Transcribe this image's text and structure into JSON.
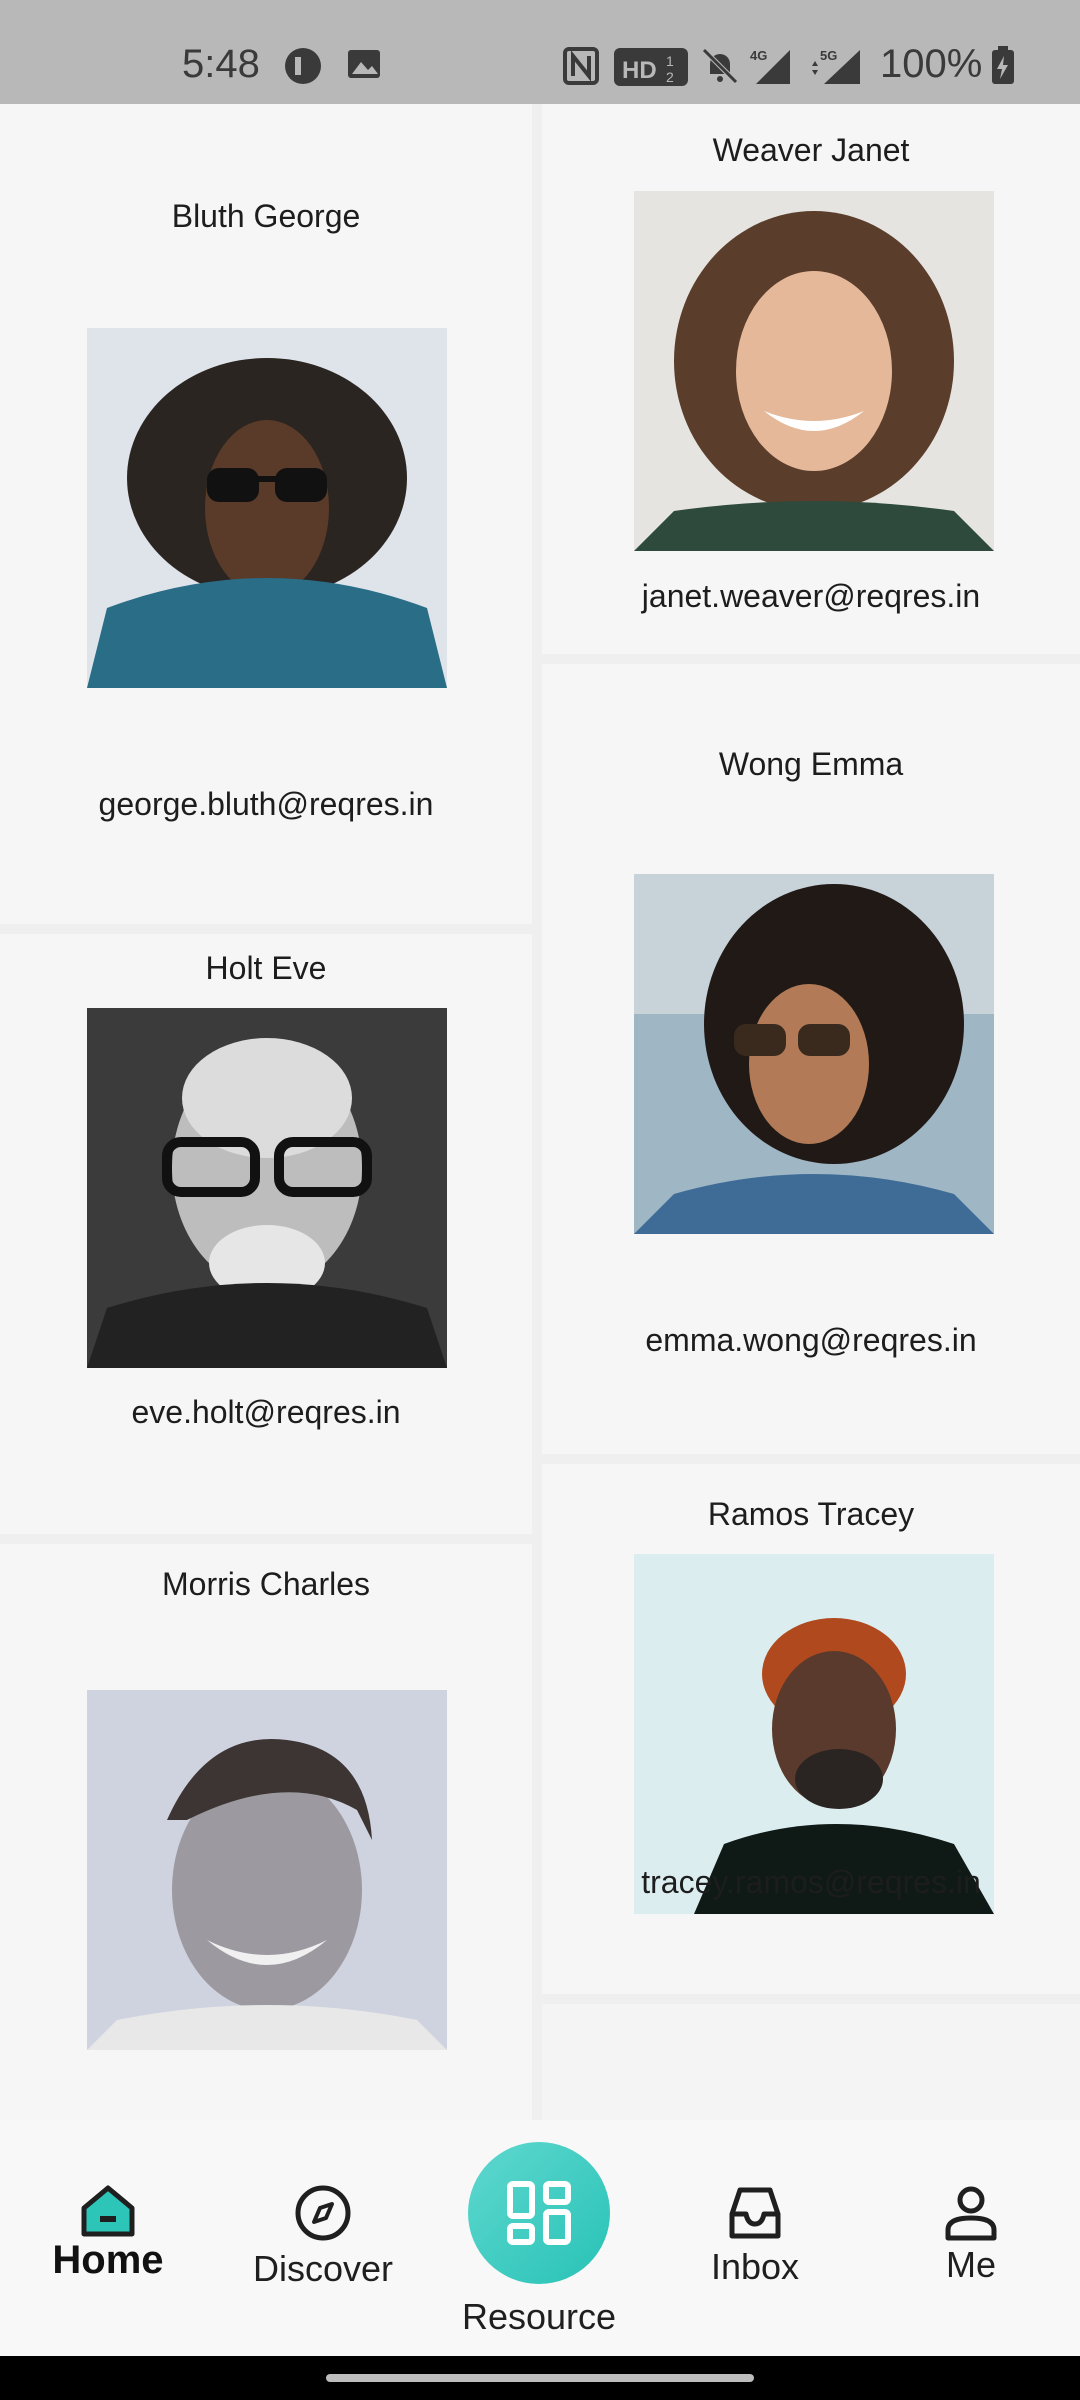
{
  "status_bar": {
    "time": "5:48",
    "battery": "100%",
    "network_badges": [
      "HD",
      "4G",
      "5G"
    ]
  },
  "users": [
    {
      "name": "Bluth George",
      "email": "george.bluth@reqres.in"
    },
    {
      "name": "Weaver Janet",
      "email": "janet.weaver@reqres.in"
    },
    {
      "name": "Holt Eve",
      "email": "eve.holt@reqres.in"
    },
    {
      "name": "Wong Emma",
      "email": "emma.wong@reqres.in"
    },
    {
      "name": "Morris Charles",
      "email": ""
    },
    {
      "name": "Ramos Tracey",
      "email": "tracey.ramos@reqres.in"
    }
  ],
  "bottom_nav": {
    "items": [
      {
        "label": "Home",
        "icon": "home-icon"
      },
      {
        "label": "Discover",
        "icon": "compass-icon"
      },
      {
        "label": "Resource",
        "icon": "grid-icon"
      },
      {
        "label": "Inbox",
        "icon": "inbox-icon"
      },
      {
        "label": "Me",
        "icon": "person-icon"
      }
    ]
  },
  "colors": {
    "accent": "#2cc5b8",
    "statusbar": "#b8b8b8"
  }
}
